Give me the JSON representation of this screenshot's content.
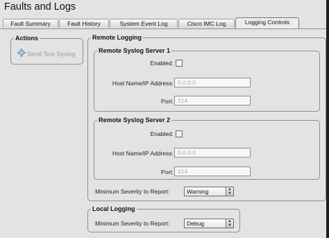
{
  "title": "Faults and Logs",
  "tabs": [
    {
      "label": "Fault Summary",
      "active": false
    },
    {
      "label": "Fault History",
      "active": false
    },
    {
      "label": "System Event Log",
      "active": false
    },
    {
      "label": "Cisco IMC Log",
      "active": false
    },
    {
      "label": "Logging Controls",
      "active": true
    }
  ],
  "actions": {
    "legend": "Actions",
    "send_test_syslog": "Send Test Syslog",
    "icon": "gear-icon"
  },
  "remote_logging": {
    "legend": "Remote Logging",
    "server1": {
      "legend": "Remote Syslog Server 1",
      "enabled_label": "Enabled:",
      "enabled": false,
      "host_label": "Host Name/IP Address:",
      "host_value": "0.0.0.0",
      "port_label": "Port:",
      "port_value": "514"
    },
    "server2": {
      "legend": "Remote Syslog Server 2",
      "enabled_label": "Enabled:",
      "enabled": false,
      "host_label": "Host Name/IP Address:",
      "host_value": "0.0.0.0",
      "port_label": "Port:",
      "port_value": "514"
    },
    "min_severity_label": "Minimum Severity to Report:",
    "min_severity_value": "Warning"
  },
  "local_logging": {
    "legend": "Local Logging",
    "min_severity_label": "Minimum Severity to Report:",
    "min_severity_value": "Debug"
  },
  "colors": {
    "panel_bg": "#e3e3e3",
    "border": "#8e8e8e",
    "disabled_text": "#9b9b9b"
  }
}
